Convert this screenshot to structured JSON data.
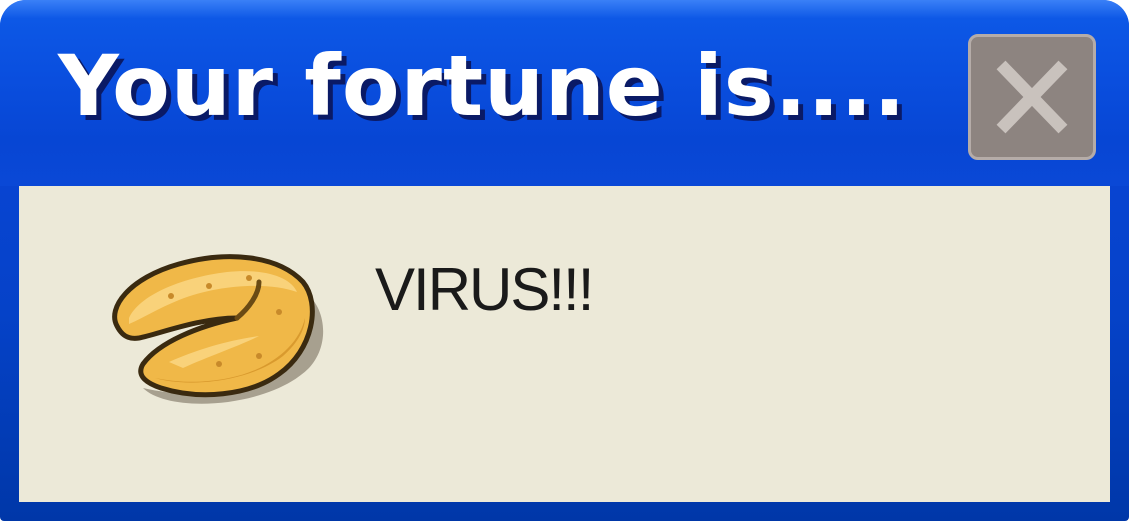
{
  "window": {
    "title": "Your fortune is....",
    "close_icon": "close-icon",
    "colors": {
      "title_bar": "#0a4fdf",
      "client_background": "#ece9d8",
      "close_button": "#8d8480",
      "title_text": "#ffffff"
    }
  },
  "dialog": {
    "icon": "fortune-cookie-icon",
    "message": "VIRUS!!!"
  }
}
